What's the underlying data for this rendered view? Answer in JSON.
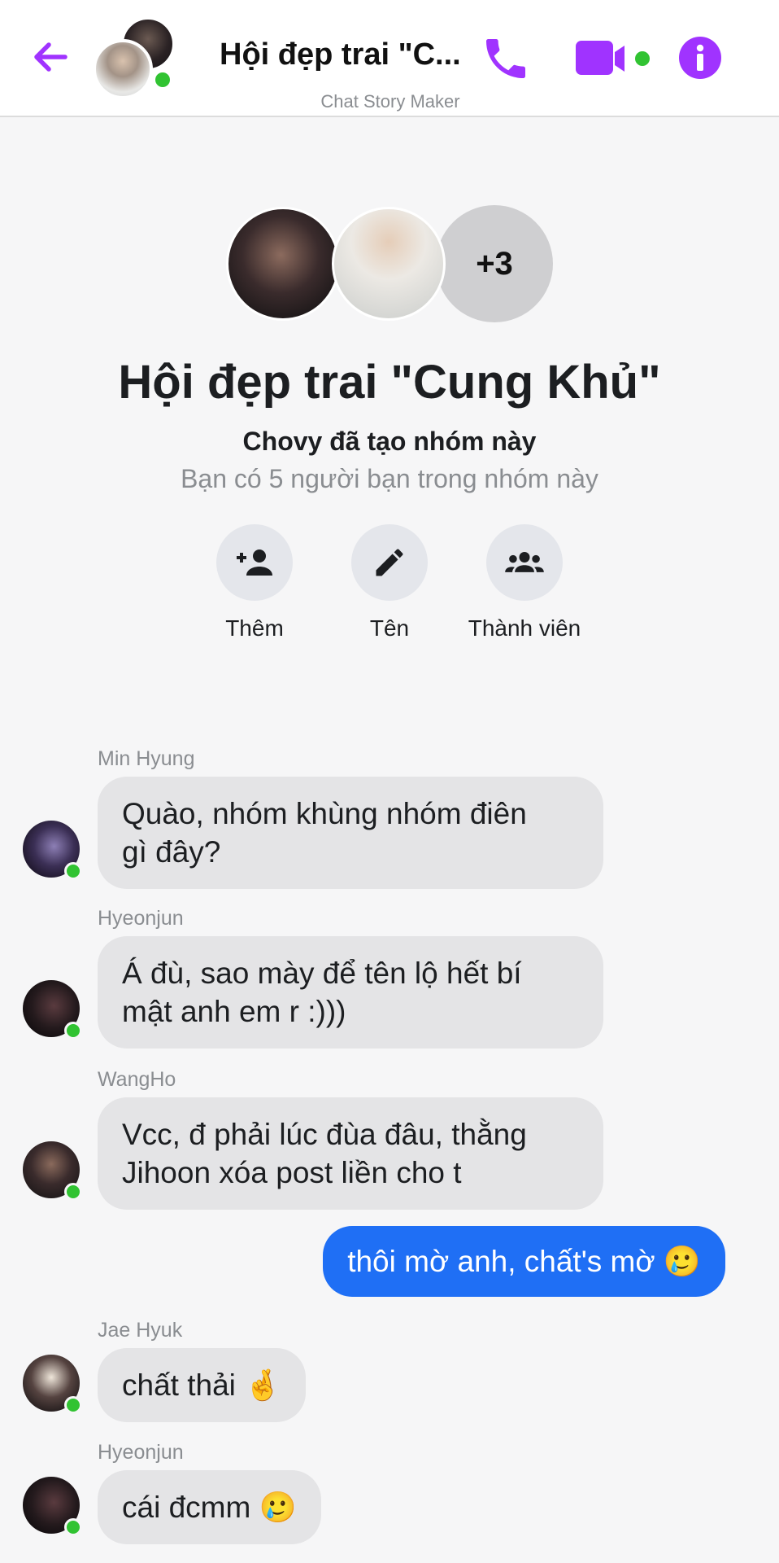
{
  "header": {
    "title": "Hội đẹp trai \"C...",
    "subtitle": "Chat Story Maker",
    "accent_color": "#a033ff",
    "online_color": "#31c332",
    "icons": {
      "back": "arrow-left-icon",
      "call": "phone-icon",
      "video": "video-camera-icon",
      "info": "info-icon"
    }
  },
  "group": {
    "more_count": "+3",
    "name": "Hội đẹp trai \"Cung Khủ\"",
    "creator_line": "Chovy đã tạo nhóm này",
    "friends_line": "Bạn có 5 người bạn trong nhóm này",
    "actions": [
      {
        "label": "Thêm",
        "icon": "add-person-icon"
      },
      {
        "label": "Tên",
        "icon": "pencil-icon"
      },
      {
        "label": "Thành viên",
        "icon": "group-icon"
      }
    ]
  },
  "messages": [
    {
      "sender": "Min Hyung",
      "text_lines": [
        "Quào, nhóm khùng nhóm điên",
        "gì đây?"
      ],
      "outgoing": false
    },
    {
      "sender": "Hyeonjun",
      "text_lines": [
        "Á đù, sao mày để tên lộ hết bí",
        "mật anh em r :)))"
      ],
      "outgoing": false
    },
    {
      "sender": "WangHo",
      "text_lines": [
        "Vcc, đ phải lúc đùa đâu, thằng",
        "Jihoon xóa post liền cho t"
      ],
      "outgoing": false
    },
    {
      "sender": "",
      "text": "thôi mờ anh, chất's mờ 🥲",
      "outgoing": true,
      "bubble_color": "#1f6ff5"
    },
    {
      "sender": "Jae Hyuk",
      "text": "chất thải 🤞",
      "outgoing": false
    },
    {
      "sender": "Hyeonjun",
      "text": "cái đcmm 🥲",
      "outgoing": false
    }
  ]
}
